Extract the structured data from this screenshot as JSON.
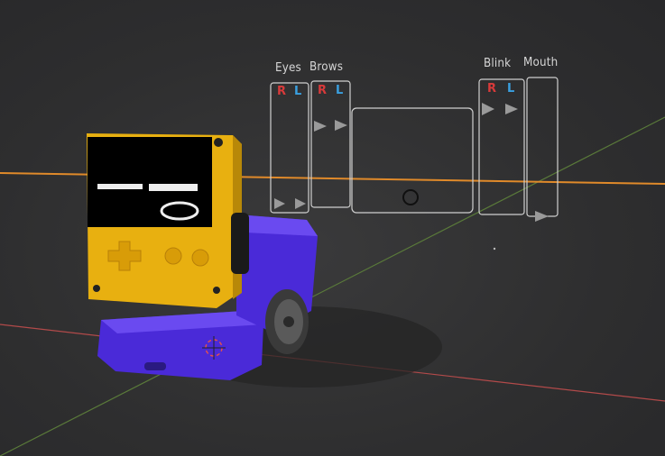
{
  "viewport": {
    "background": "#2f2f30",
    "x_axis_color": "#b24a4a",
    "y_axis_color": "#5a7a3a",
    "horizon_line_color": "#e08a2a"
  },
  "rig_panel": {
    "labels": {
      "eyes": "Eyes",
      "brows": "Brows",
      "blink": "Blink",
      "mouth": "Mouth"
    },
    "side_labels": {
      "right": "R",
      "left": "L"
    },
    "right_color": "#d83a3a",
    "left_color": "#3aa0e0",
    "frame_color": "#d0d0d0"
  },
  "robot": {
    "body_color": "#4a2ad8",
    "device_color": "#e8b010",
    "screen_color": "#000000",
    "wheel_color": "#3a3a3a",
    "icons": [
      "dpad-icon",
      "button-icon",
      "eye-icon",
      "mouth-icon"
    ]
  },
  "origin_cursor": "3d-cursor-icon"
}
